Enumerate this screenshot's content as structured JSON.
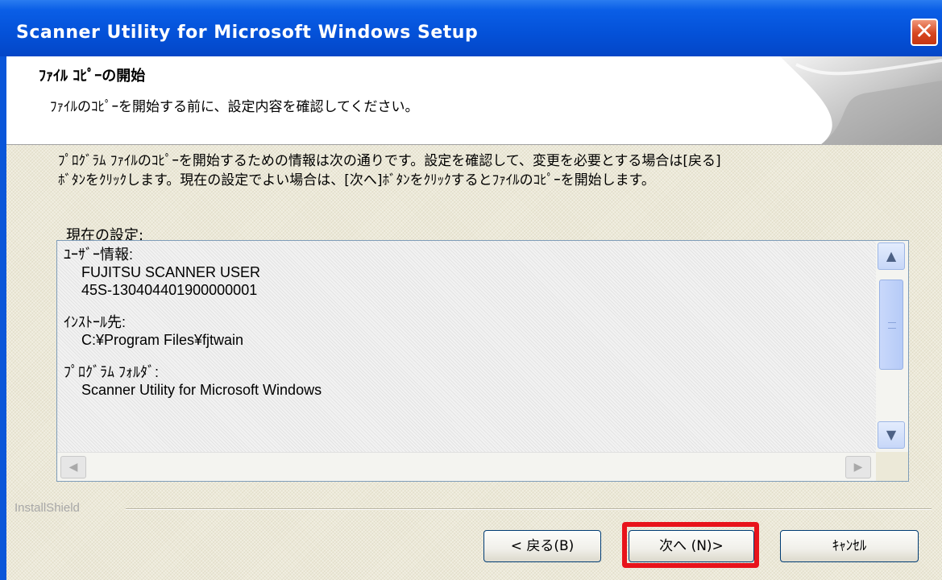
{
  "window": {
    "title": "Scanner Utility for Microsoft Windows Setup",
    "close_label": "✕"
  },
  "header": {
    "title": "ﾌｧｲﾙ ｺﾋﾟｰの開始",
    "subtitle": "ﾌｧｲﾙのｺﾋﾟｰを開始する前に、設定内容を確認してください。"
  },
  "description": {
    "line1": "ﾌﾟﾛｸﾞﾗﾑ ﾌｧｲﾙのｺﾋﾟｰを開始するための情報は次の通りです。設定を確認して、変更を必要とする場合は[戻る]",
    "line2": "ﾎﾞﾀﾝをｸﾘｯｸします。現在の設定でよい場合は、[次へ]ﾎﾞﾀﾝをｸﾘｯｸするとﾌｧｲﾙのｺﾋﾟｰを開始します。"
  },
  "settings": {
    "label": "現在の設定:",
    "user_info_heading": "ﾕｰｻﾞｰ情報:",
    "user_name": "FUJITSU SCANNER USER",
    "serial": "45S-130404401900000001",
    "install_dest_heading": "ｲﾝｽﾄｰﾙ先:",
    "install_path": "C:¥Program Files¥fjtwain",
    "program_folder_heading": "ﾌﾟﾛｸﾞﾗﾑ ﾌｫﾙﾀﾞ:",
    "program_folder": "Scanner Utility for Microsoft Windows"
  },
  "footer": {
    "brand": "InstallShield",
    "back_label": "< 戻る(B)",
    "next_label": "次へ (N)>",
    "cancel_label": "ｷｬﾝｾﾙ"
  },
  "colors": {
    "highlight": "#e8131b",
    "titlebar": "#0451d8"
  }
}
